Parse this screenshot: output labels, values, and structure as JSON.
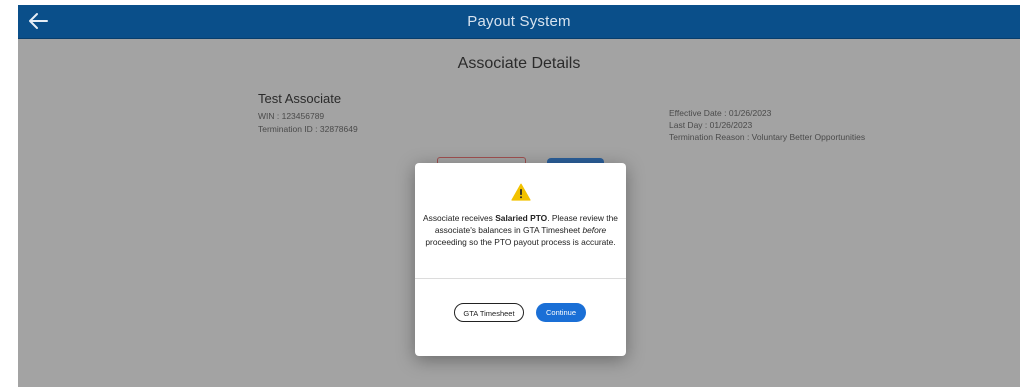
{
  "header": {
    "back_icon": "arrow-left-icon",
    "title": "Payout System",
    "color": "#0a4f8a"
  },
  "page": {
    "heading": "Associate Details"
  },
  "associate": {
    "name": "Test Associate",
    "win": "WIN : 123456789",
    "termination_id": "Termination ID : 32878649"
  },
  "termination": {
    "effective_date": "Effective Date : 01/26/2023",
    "last_day": "Last Day : 01/26/2023",
    "reason": "Termination Reason : Voluntary Better Opportunities"
  },
  "modal": {
    "icon": "warning-icon",
    "message_prefix": "Associate receives ",
    "message_bold": "Salaried PTO",
    "message_middle": ". Please review the associate's balances in GTA Timesheet ",
    "message_italic": "before",
    "message_suffix": " proceeding so the PTO payout process is accurate.",
    "secondary_button": "GTA Timesheet",
    "primary_button": "Continue",
    "primary_color": "#1a6fd6"
  }
}
